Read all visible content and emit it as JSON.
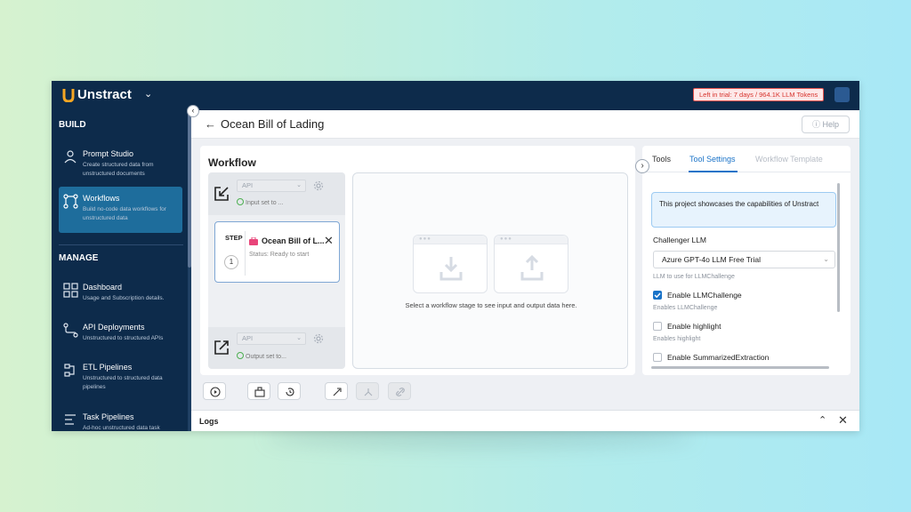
{
  "brand": {
    "name": "Unstract"
  },
  "topbar": {
    "trial_text": "Left in trial: 7 days / 964.1K LLM Tokens"
  },
  "sidebar": {
    "build_label": "BUILD",
    "manage_label": "MANAGE",
    "build_items": [
      {
        "title": "Prompt Studio",
        "desc": "Create structured data from unstructured documents",
        "icon": "prompt-studio-icon"
      },
      {
        "title": "Workflows",
        "desc": "Build no-code data workflows for unstructured data",
        "icon": "workflow-icon"
      }
    ],
    "manage_items": [
      {
        "title": "Dashboard",
        "desc": "Usage and Subscription details.",
        "icon": "dashboard-icon"
      },
      {
        "title": "API Deployments",
        "desc": "Unstructured to structured APIs",
        "icon": "api-icon"
      },
      {
        "title": "ETL Pipelines",
        "desc": "Unstructured to structured data pipelines",
        "icon": "etl-icon"
      },
      {
        "title": "Task Pipelines",
        "desc": "Ad-hoc unstructured data task",
        "icon": "task-icon"
      }
    ]
  },
  "header": {
    "back_icon": "arrow-left-icon",
    "title": "Ocean Bill of Lading",
    "help_label": "Help"
  },
  "workflow": {
    "title": "Workflow",
    "input": {
      "select_value": "API",
      "status": "Input set to ..."
    },
    "output": {
      "select_value": "API",
      "status": "Output set to..."
    },
    "step": {
      "label": "STEP",
      "number": "1",
      "name": "Ocean Bill of L...",
      "status": "Status: Ready to start"
    },
    "preview_text": "Select a workflow stage to see input and output data here."
  },
  "right_panel": {
    "tabs": [
      "Tools",
      "Tool Settings",
      "Workflow Template"
    ],
    "active_tab": "Tool Settings",
    "info": "This project showcases the capabilities of Unstract",
    "challenger_label": "Challenger LLM",
    "challenger_value": "Azure GPT-4o LLM Free Trial",
    "challenger_help": "LLM to use for LLMChallenge",
    "options": [
      {
        "label": "Enable LLMChallenge",
        "help": "Enables LLMChallenge",
        "checked": true
      },
      {
        "label": "Enable highlight",
        "help": "Enables highlight",
        "checked": false
      },
      {
        "label": "Enable SummarizedExtraction",
        "help": "",
        "checked": false
      }
    ]
  },
  "logs": {
    "label": "Logs"
  },
  "colors": {
    "navy": "#0d2b4b",
    "accent": "#1a73c8",
    "active_item": "#1e6d9c",
    "trial_red": "#d6332d"
  }
}
